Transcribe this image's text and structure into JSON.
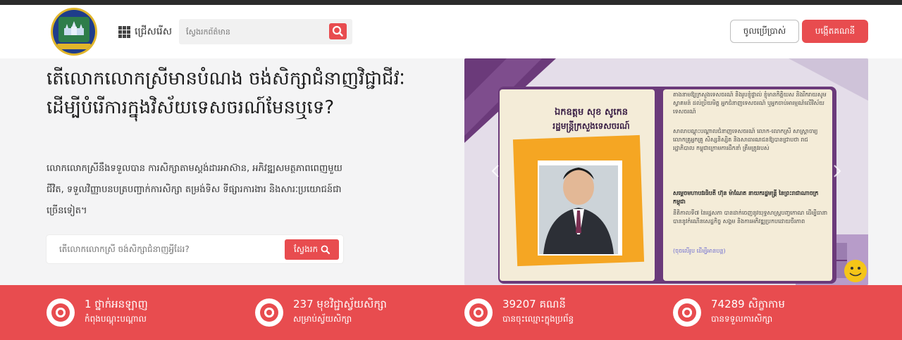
{
  "header": {
    "logo_text": "MINISTRY OF TOURISM",
    "menu_label": "ជ្រើសរើស",
    "search_placeholder": "ស្វែងរកព័ត៌មាន",
    "login_label": "ចូលប្រើប្រាស់",
    "register_label": "បង្កើតគណនី"
  },
  "hero": {
    "title": "តើលោកលោកស្រីមានបំណង ចង់សិក្សាជំនាញវិជ្ជាជីវៈ ដើម្បីបំរើការក្នុងវិស័យទេសចរណ៍មែនឬទេ?",
    "description": "លោកលោកស្រីនឹងទទួលបាន ការសិក្សាតាមស្តង់ដារអាស៊ាន, អភិវឌ្ឍសមត្ថភាពពេញមួយជីវិត, ទទួលវិញ្ញាបនបត្របញ្ជាក់ការសិក្សា តម្រង់ទិស ទីផ្សារការងារ និងសារៈប្រយោជន៍ជាច្រើនទៀត។",
    "search_placeholder": "តើលោកលោកស្រី ចង់សិក្សាជំនាញអ្វីដែរ?",
    "search_button": "ស្វែងរក"
  },
  "banner": {
    "minister_name": "ឯកឧត្តម សុខ សូកេន",
    "minister_title": "រដ្ឋមន្ត្រីក្រសួងទេសចរណ៍",
    "paragraph1": "តាងនាមឱ្យក្រសួងទេសចរណ៍ និងរូបខ្ញុំផ្ទាល់ ខ្ញុំមានកិត្តិយស និងរីករាយសូមស្វាគមន៍ ដល់ប្រិយមិត្ត អ្នកជំនាញទេសចរណ៍ ឬអ្នកចាប់អារម្មណ៍លើវិស័យទេសចរណ៍",
    "paragraph2": "សាលាបណ្តុះបណ្តាលជំនាញទេសចរណ៍ លោក-លោកស្រី សាស្ត្រាចារ្យ លោកគ្រូអ្នកគ្រូ សិស្សនិស្សិត និងសាធារណជនឱ្យបានជ្រាបថា រាជរដ្ឋាភិបាល កម្ពុជាក្រោមការដឹកនាំ ត្រឹមត្រូវរបស់",
    "highlight": "សម្តេចមហាបវរធិបតី ហ៊ុន ម៉ាណែត នាយករដ្ឋមន្ត្រី នៃព្រះរាជាណាចក្រកម្ពុជា",
    "paragraph3": "នីតិកាលទី៧ នៃរដ្ឋសភា បានដាក់ចេញនូវយុទ្ធសាស្ត្របញ្ចកោណ ដើម្បីធានាបាននូវកំណើនសេដ្ឋកិច្ច សង្គម និងការអភិវឌ្ឍប្រកបដោយចីរភាព",
    "read_more": "(ចុចលើរូប ដើម្បីអានបន្ត)"
  },
  "stats": [
    {
      "value": "1 ថ្នាក់អនឡាញ",
      "label": "កំពុងបណ្តុះបណ្តាល"
    },
    {
      "value": "237 មុខវិជ្ជាស្វ័យសិក្សា",
      "label": "សម្រាប់ស្វ័យសិក្សា"
    },
    {
      "value": "39207 គណនី",
      "label": "បានចុះឈ្មោះក្នុងប្រព័ន្ធ"
    },
    {
      "value": "74289 សិក្ខាកាម",
      "label": "បានទទួលការសិក្សា"
    }
  ],
  "colors": {
    "accent": "#e84c4f",
    "banner_purple": "#6b3a7a",
    "banner_orange": "#f5a623"
  }
}
